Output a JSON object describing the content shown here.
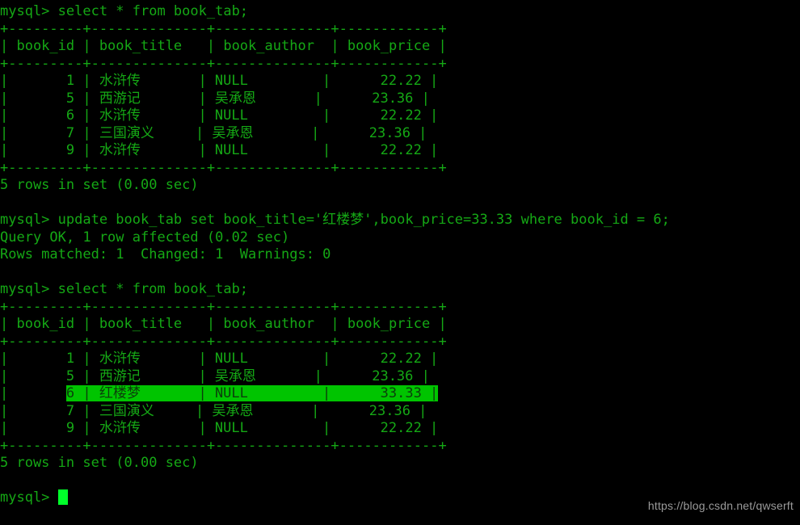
{
  "terminal": {
    "prompt": "mysql> ",
    "colors": {
      "background": "#000000",
      "text": "#15a815",
      "highlight_background": "#00c400",
      "highlight_text": "#0b3d0b",
      "cursor": "#00ff2a",
      "watermark": "#9a9a9a"
    },
    "watermark": "https://blog.csdn.net/qwserft",
    "columns": {
      "separator": "+---------+--------------+--------------+------------+",
      "header": "| book_id | book_title   | book_author  | book_price |"
    },
    "lines": [
      {
        "type": "command",
        "text": "mysql> select * from book_tab;"
      },
      {
        "type": "rule",
        "text": "+---------+--------------+--------------+------------+"
      },
      {
        "type": "header",
        "text": "| book_id | book_title   | book_author  | book_price |"
      },
      {
        "type": "rule",
        "text": "+---------+--------------+--------------+------------+"
      },
      {
        "type": "row",
        "text": "|       1 | 水浒传       | NULL         |      22.22 |"
      },
      {
        "type": "row",
        "text": "|       5 | 西游记       | 吴承恩       |      23.36 |"
      },
      {
        "type": "row",
        "text": "|       6 | 水浒传       | NULL         |      22.22 |"
      },
      {
        "type": "row",
        "text": "|       7 | 三国演义     | 吴承恩       |      23.36 |"
      },
      {
        "type": "row",
        "text": "|       9 | 水浒传       | NULL         |      22.22 |"
      },
      {
        "type": "rule",
        "text": "+---------+--------------+--------------+------------+"
      },
      {
        "type": "status",
        "text": "5 rows in set (0.00 sec)"
      },
      {
        "type": "blank",
        "text": " "
      },
      {
        "type": "command",
        "text": "mysql> update book_tab set book_title='红楼梦',book_price=33.33 where book_id = 6;"
      },
      {
        "type": "status",
        "text": "Query OK, 1 row affected (0.02 sec)"
      },
      {
        "type": "status",
        "text": "Rows matched: 1  Changed: 1  Warnings: 0"
      },
      {
        "type": "blank",
        "text": " "
      },
      {
        "type": "command",
        "text": "mysql> select * from book_tab;"
      },
      {
        "type": "rule",
        "text": "+---------+--------------+--------------+------------+"
      },
      {
        "type": "header",
        "text": "| book_id | book_title   | book_author  | book_price |"
      },
      {
        "type": "rule",
        "text": "+---------+--------------+--------------+------------+"
      },
      {
        "type": "row",
        "text": "|       1 | 水浒传       | NULL         |      22.22 |"
      },
      {
        "type": "row",
        "text": "|       5 | 西游记       | 吴承恩       |      23.36 |"
      },
      {
        "type": "row_highlight",
        "prefix": "|       ",
        "text": "6 | 红楼梦       | NULL         |      33.33 |"
      },
      {
        "type": "row",
        "text": "|       7 | 三国演义     | 吴承恩       |      23.36 |"
      },
      {
        "type": "row",
        "text": "|       9 | 水浒传       | NULL         |      22.22 |"
      },
      {
        "type": "rule",
        "text": "+---------+--------------+--------------+------------+"
      },
      {
        "type": "status",
        "text": "5 rows in set (0.00 sec)"
      },
      {
        "type": "blank",
        "text": " "
      },
      {
        "type": "prompt_cursor",
        "text": "mysql> "
      }
    ],
    "query_1": {
      "sql": "select * from book_tab;",
      "result_count": "5 rows in set (0.00 sec)",
      "headers": [
        "book_id",
        "book_title",
        "book_author",
        "book_price"
      ],
      "rows": [
        [
          "1",
          "水浒传",
          "NULL",
          "22.22"
        ],
        [
          "5",
          "西游记",
          "吴承恩",
          "23.36"
        ],
        [
          "6",
          "水浒传",
          "NULL",
          "22.22"
        ],
        [
          "7",
          "三国演义",
          "吴承恩",
          "23.36"
        ],
        [
          "9",
          "水浒传",
          "NULL",
          "22.22"
        ]
      ]
    },
    "update_statement": {
      "sql": "update book_tab set book_title='红楼梦',book_price=33.33 where book_id = 6;",
      "result": "Query OK, 1 row affected (0.02 sec)",
      "detail": "Rows matched: 1  Changed: 1  Warnings: 0"
    },
    "query_2": {
      "sql": "select * from book_tab;",
      "result_count": "5 rows in set (0.00 sec)",
      "headers": [
        "book_id",
        "book_title",
        "book_author",
        "book_price"
      ],
      "rows": [
        [
          "1",
          "水浒传",
          "NULL",
          "22.22"
        ],
        [
          "5",
          "西游记",
          "吴承恩",
          "23.36"
        ],
        [
          "6",
          "红楼梦",
          "NULL",
          "33.33"
        ],
        [
          "7",
          "三国演义",
          "吴承恩",
          "23.36"
        ],
        [
          "9",
          "水浒传",
          "NULL",
          "22.22"
        ]
      ],
      "highlighted_row_index": 2
    }
  }
}
